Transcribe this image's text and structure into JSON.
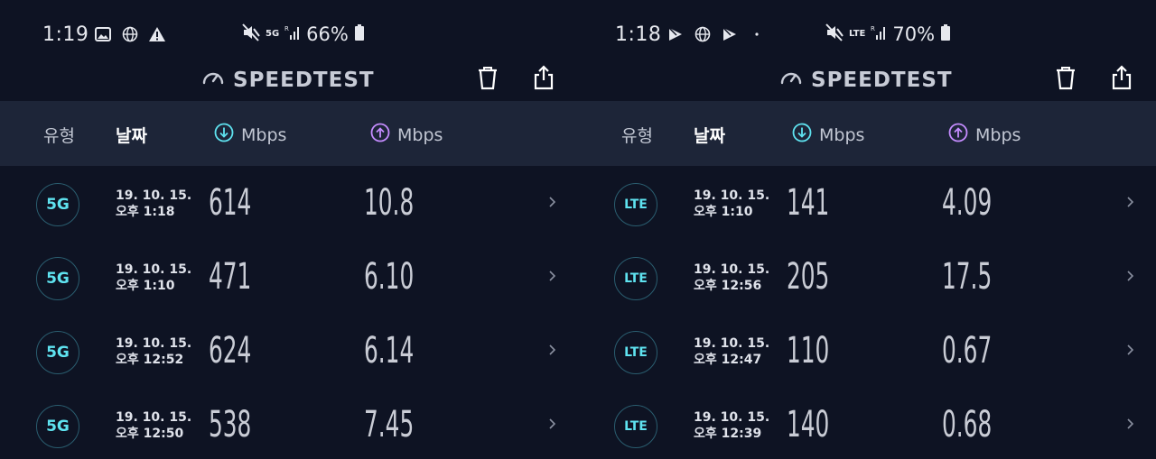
{
  "panels": [
    {
      "status": {
        "time": "1:19",
        "battery": "66%",
        "network": "5G"
      },
      "app": {
        "title": "SPEEDTEST"
      },
      "columns": {
        "type": "유형",
        "date": "날짜",
        "down_unit": "Mbps",
        "up_unit": "Mbps"
      },
      "rows": [
        {
          "type": "5G",
          "date": "19. 10. 15.",
          "time": "오후 1:18",
          "down": "614",
          "up": "10.8"
        },
        {
          "type": "5G",
          "date": "19. 10. 15.",
          "time": "오후 1:10",
          "down": "471",
          "up": "6.10"
        },
        {
          "type": "5G",
          "date": "19. 10. 15.",
          "time": "오후 12:52",
          "down": "624",
          "up": "6.14"
        },
        {
          "type": "5G",
          "date": "19. 10. 15.",
          "time": "오후 12:50",
          "down": "538",
          "up": "7.45"
        }
      ]
    },
    {
      "status": {
        "time": "1:18",
        "battery": "70%",
        "network": "LTE"
      },
      "app": {
        "title": "SPEEDTEST"
      },
      "columns": {
        "type": "유형",
        "date": "날짜",
        "down_unit": "Mbps",
        "up_unit": "Mbps"
      },
      "rows": [
        {
          "type": "LTE",
          "date": "19. 10. 15.",
          "time": "오후 1:10",
          "down": "141",
          "up": "4.09"
        },
        {
          "type": "LTE",
          "date": "19. 10. 15.",
          "time": "오후 12:56",
          "down": "205",
          "up": "17.5"
        },
        {
          "type": "LTE",
          "date": "19. 10. 15.",
          "time": "오후 12:47",
          "down": "110",
          "up": "0.67"
        },
        {
          "type": "LTE",
          "date": "19. 10. 15.",
          "time": "오후 12:39",
          "down": "140",
          "up": "0.68"
        }
      ]
    }
  ],
  "colors": {
    "background": "#0e1323",
    "header_band": "#1d2538",
    "badge_text": "#5fe3f0",
    "download": "#5fe3f0",
    "upload": "#c58cff"
  }
}
